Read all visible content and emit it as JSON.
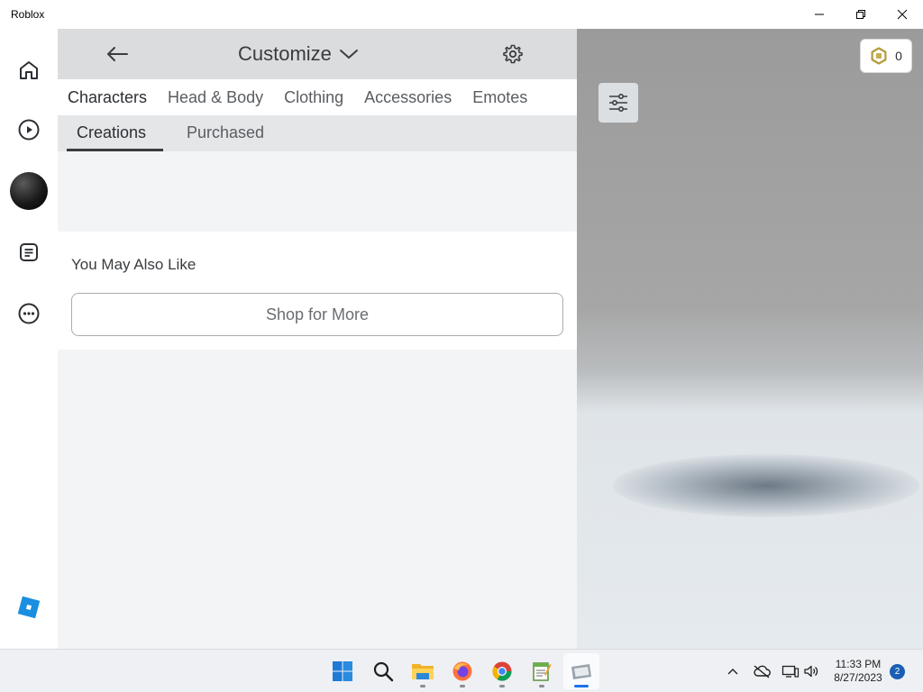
{
  "window": {
    "title": "Roblox"
  },
  "rail": {
    "items": [
      {
        "name": "home-icon"
      },
      {
        "name": "play-icon"
      },
      {
        "name": "avatar"
      },
      {
        "name": "chat-icon"
      },
      {
        "name": "more-icon"
      }
    ],
    "logo": "roblox-logo"
  },
  "header": {
    "title": "Customize"
  },
  "tabs": [
    "Characters",
    "Head & Body",
    "Clothing",
    "Accessories",
    "Emotes"
  ],
  "subtabs": [
    "Creations",
    "Purchased"
  ],
  "also_like": {
    "heading": "You May Also Like",
    "shop_button": "Shop for More"
  },
  "robux": {
    "balance": "0"
  },
  "taskbar": {
    "apps": [
      "windows-start-icon",
      "search-icon",
      "file-explorer-icon",
      "firefox-icon",
      "chrome-icon",
      "notepad-icon",
      "roblox-app-icon"
    ],
    "time": "11:33 PM",
    "date": "8/27/2023",
    "notification_count": "2"
  },
  "colors": {
    "header_bg": "#dadcde",
    "panel_bg": "#f2f4f5",
    "accent": "#1a73e8"
  }
}
